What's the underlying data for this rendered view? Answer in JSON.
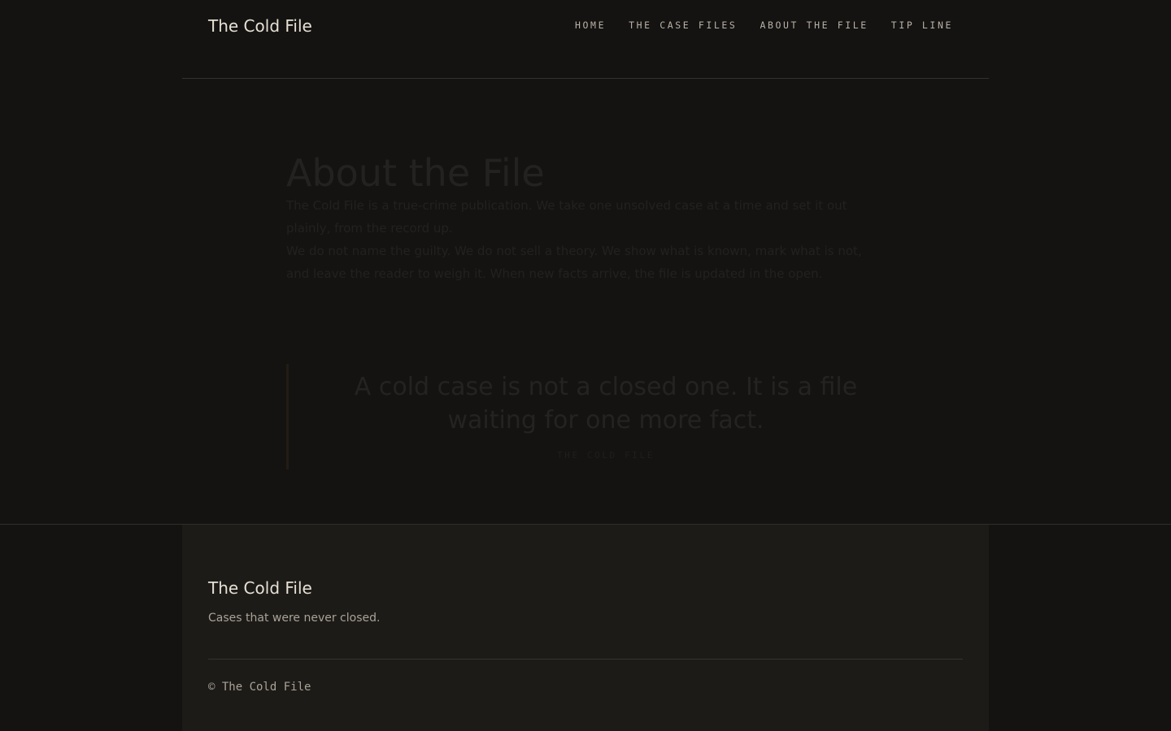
{
  "header": {
    "brand": "The Cold File",
    "nav": [
      {
        "label": "HOME"
      },
      {
        "label": "THE CASE FILES"
      },
      {
        "label": "ABOUT THE FILE"
      },
      {
        "label": "TIP LINE"
      }
    ]
  },
  "main": {
    "title": "About the File",
    "paragraphs": [
      "The Cold File is a true-crime publication. We take one unsolved case at a time and set it out plainly, from the record up.",
      "We do not name the guilty. We do not sell a theory. We show what is known, mark what is not, and leave the reader to weigh it. When new facts arrive, the file is updated in the open."
    ],
    "quote": {
      "text": "A cold case is not a closed one. It is a file waiting for one more fact.",
      "cite": "THE COLD FILE"
    }
  },
  "footer": {
    "brand": "The Cold File",
    "tagline": "Cases that were never closed.",
    "copyright": "© The Cold File"
  },
  "colors": {
    "background": "#141312",
    "footer_background": "#1c1b18",
    "brand_text": "#e6e0d4",
    "nav_text": "#b8b1a6",
    "muted_text": "#a9a296",
    "quote_rule": "#231c14"
  }
}
